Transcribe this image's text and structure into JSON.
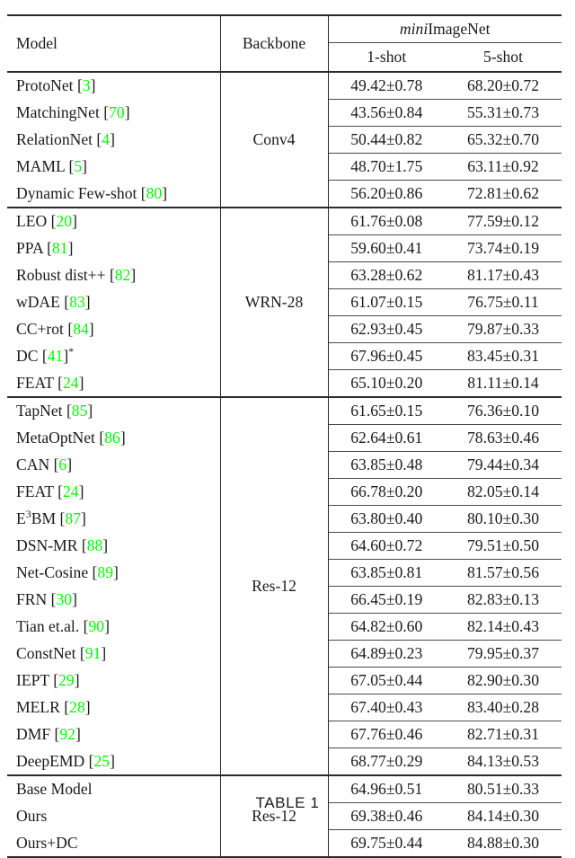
{
  "table": {
    "header": {
      "model": "Model",
      "backbone": "Backbone",
      "dataset_italic": "mini",
      "dataset_rest": "ImageNet",
      "shot1": "1-shot",
      "shot5": "5-shot"
    },
    "ref_color": "#00ff00",
    "blocks": [
      {
        "backbone": "Conv4",
        "rows": [
          {
            "model": "ProtoNet",
            "ref": "3",
            "suffix": "",
            "shot1": "49.42±0.78",
            "shot5": "68.20±0.72",
            "bold1": false,
            "bold5": false
          },
          {
            "model": "MatchingNet",
            "ref": "70",
            "suffix": "",
            "shot1": "43.56±0.84",
            "shot5": "55.31±0.73",
            "bold1": false,
            "bold5": false
          },
          {
            "model": "RelationNet",
            "ref": "4",
            "suffix": "",
            "shot1": "50.44±0.82",
            "shot5": "65.32±0.70",
            "bold1": false,
            "bold5": false
          },
          {
            "model": "MAML",
            "ref": "5",
            "suffix": "",
            "shot1": "48.70±1.75",
            "shot5": "63.11±0.92",
            "bold1": false,
            "bold5": false
          },
          {
            "model": "Dynamic Few-shot",
            "ref": "80",
            "suffix": "",
            "shot1": "56.20±0.86",
            "shot5": "72.81±0.62",
            "bold1": false,
            "bold5": false
          }
        ]
      },
      {
        "backbone": "WRN-28",
        "rows": [
          {
            "model": "LEO",
            "ref": "20",
            "suffix": "",
            "shot1": "61.76±0.08",
            "shot5": "77.59±0.12",
            "bold1": false,
            "bold5": false
          },
          {
            "model": "PPA",
            "ref": "81",
            "suffix": "",
            "shot1": "59.60±0.41",
            "shot5": "73.74±0.19",
            "bold1": false,
            "bold5": false
          },
          {
            "model": "Robust dist++",
            "ref": "82",
            "suffix": "",
            "shot1": "63.28±0.62",
            "shot5": "81.17±0.43",
            "bold1": false,
            "bold5": false
          },
          {
            "model": "wDAE",
            "ref": "83",
            "suffix": "",
            "shot1": "61.07±0.15",
            "shot5": "76.75±0.11",
            "bold1": false,
            "bold5": false
          },
          {
            "model": "CC+rot",
            "ref": "84",
            "suffix": "",
            "shot1": "62.93±0.45",
            "shot5": "79.87±0.33",
            "bold1": false,
            "bold5": false
          },
          {
            "model": "DC",
            "ref": "41",
            "suffix": "*",
            "shot1": "67.96±0.45",
            "shot5": "83.45±0.31",
            "bold1": false,
            "bold5": false
          },
          {
            "model": "FEAT",
            "ref": "24",
            "suffix": "",
            "shot1": "65.10±0.20",
            "shot5": "81.11±0.14",
            "bold1": false,
            "bold5": false
          }
        ]
      },
      {
        "backbone": "Res-12",
        "rows": [
          {
            "model": "TapNet",
            "ref": "85",
            "suffix": "",
            "shot1": "61.65±0.15",
            "shot5": "76.36±0.10",
            "bold1": false,
            "bold5": false
          },
          {
            "model": "MetaOptNet",
            "ref": "86",
            "suffix": "",
            "shot1": "62.64±0.61",
            "shot5": "78.63±0.46",
            "bold1": false,
            "bold5": false
          },
          {
            "model": "CAN",
            "ref": "6",
            "suffix": "",
            "shot1": "63.85±0.48",
            "shot5": "79.44±0.34",
            "bold1": false,
            "bold5": false
          },
          {
            "model": "FEAT",
            "ref": "24",
            "suffix": "",
            "shot1": "66.78±0.20",
            "shot5": "82.05±0.14",
            "bold1": false,
            "bold5": false
          },
          {
            "model": "E3BM",
            "model_sup": "3",
            "model_pre": "E",
            "model_post": "BM",
            "ref": "87",
            "suffix": "",
            "shot1": "63.80±0.40",
            "shot5": "80.10±0.30",
            "bold1": false,
            "bold5": false
          },
          {
            "model": "DSN-MR",
            "ref": "88",
            "suffix": "",
            "shot1": "64.60±0.72",
            "shot5": "79.51±0.50",
            "bold1": false,
            "bold5": false
          },
          {
            "model": "Net-Cosine",
            "ref": "89",
            "suffix": "",
            "shot1": "63.85±0.81",
            "shot5": "81.57±0.56",
            "bold1": false,
            "bold5": false
          },
          {
            "model": "FRN",
            "ref": "30",
            "suffix": "",
            "shot1": "66.45±0.19",
            "shot5": "82.83±0.13",
            "bold1": false,
            "bold5": false
          },
          {
            "model": "Tian et.al.",
            "ref": "90",
            "suffix": "",
            "shot1": "64.82±0.60",
            "shot5": "82.14±0.43",
            "bold1": false,
            "bold5": false
          },
          {
            "model": "ConstNet",
            "ref": "91",
            "suffix": "",
            "shot1": "64.89±0.23",
            "shot5": "79.95±0.37",
            "bold1": false,
            "bold5": false
          },
          {
            "model": "IEPT",
            "ref": "29",
            "suffix": "",
            "shot1": "67.05±0.44",
            "shot5": "82.90±0.30",
            "bold1": false,
            "bold5": false
          },
          {
            "model": "MELR",
            "ref": "28",
            "suffix": "",
            "shot1": "67.40±0.43",
            "shot5": "83.40±0.28",
            "bold1": false,
            "bold5": false
          },
          {
            "model": "DMF",
            "ref": "92",
            "suffix": "",
            "shot1": "67.76±0.46",
            "shot5": "82.71±0.31",
            "bold1": false,
            "bold5": false
          },
          {
            "model": "DeepEMD",
            "ref": "25",
            "suffix": "",
            "shot1": "68.77±0.29",
            "shot5": "84.13±0.53",
            "bold1": false,
            "bold5": false
          }
        ]
      },
      {
        "backbone": "Res-12",
        "rows": [
          {
            "model": "Base Model",
            "ref": "",
            "suffix": "",
            "shot1": "64.96±0.51",
            "shot5": "80.51±0.33",
            "bold1": false,
            "bold5": true
          },
          {
            "model": "Ours",
            "ref": "",
            "suffix": "",
            "shot1": "69.38±0.46",
            "shot5": "84.14±0.30",
            "bold1": true,
            "bold5": true
          },
          {
            "model": "Ours+DC",
            "ref": "",
            "suffix": "",
            "shot1": "69.75±0.44",
            "shot5": "84.88±0.30",
            "bold1": true,
            "bold5": true
          }
        ]
      }
    ]
  },
  "caption": "TABLE 1"
}
